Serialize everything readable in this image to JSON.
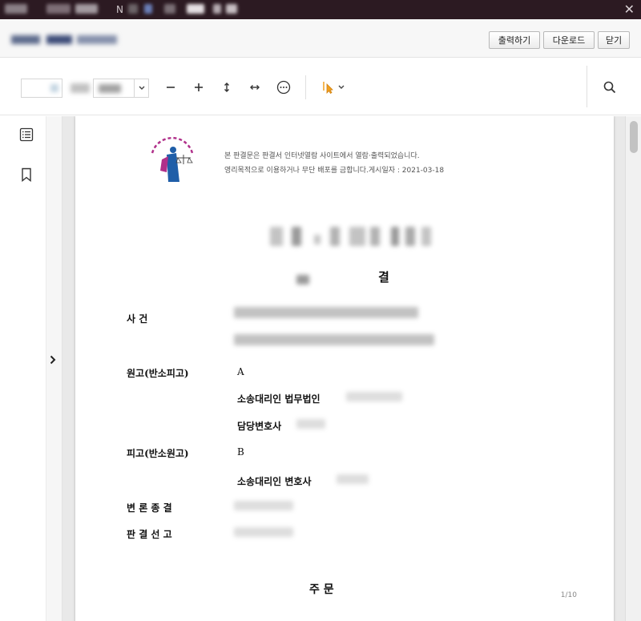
{
  "titlebar": {
    "letter": "N",
    "close": "✕"
  },
  "header": {
    "buttons": {
      "print": "출력하기",
      "download": "다운로드",
      "close": "닫기"
    }
  },
  "document": {
    "notice_line1": "본 판결문은 판결서 인터넷열람 사이트에서 열람·출력되었습니다.",
    "notice_line2": "영리목적으로 이용하거나 무단 배포를 금합니다.게시일자 : 2021-03-18",
    "heading_char": "결",
    "case_label": "사    건",
    "plaintiff_label": "원고(반소피고)",
    "plaintiff_name": "A",
    "plaintiff_counsel": "소송대리인 법무법인",
    "plaintiff_attorney": "담당변호사",
    "defendant_label": "피고(반소원고)",
    "defendant_name": "B",
    "defendant_counsel": "소송대리인 변호사",
    "closing_label": "변 론 종 결",
    "judgment_label": "판 결 선 고",
    "order_title": "주        문",
    "page_indicator": "1/10"
  },
  "colors": {
    "titlebar": "#2c1a22",
    "accent_cursor": "#f0a020",
    "seal_blue": "#1f5ea8",
    "seal_magenta": "#b0308a"
  }
}
